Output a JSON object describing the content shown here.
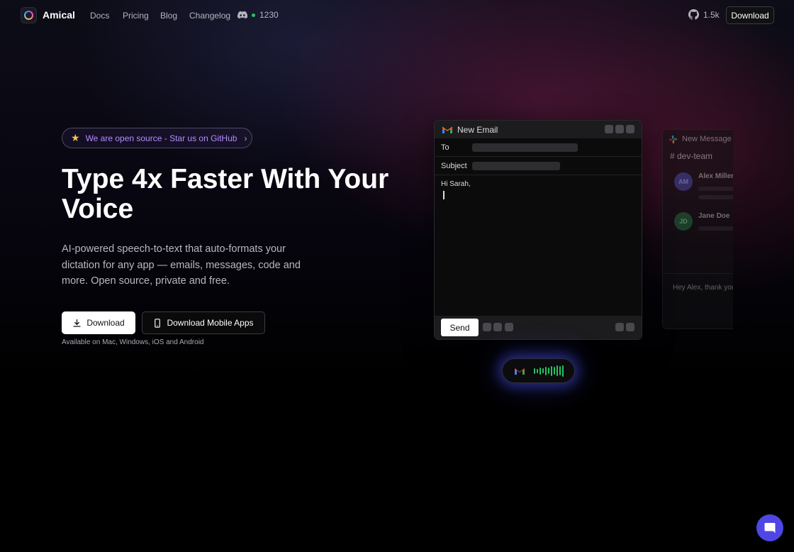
{
  "nav": {
    "brand": "Amical",
    "links": [
      "Docs",
      "Pricing",
      "Blog",
      "Changelog"
    ],
    "discord_count": "1230",
    "github_stars": "1.5k",
    "download_label": "Download"
  },
  "hero": {
    "badge_text": "We are open source - Star us on GitHub",
    "title": "Type 4x Faster With Your Voice",
    "subtitle": "AI-powered speech-to-text that auto-formats your dictation for any app — emails, messages, code and more. Open source, private and free.",
    "download_label": "Download",
    "mobile_label": "Download Mobile Apps",
    "availability": "Available on Mac, Windows, iOS and Android"
  },
  "email_window": {
    "title": "New Email",
    "to_label": "To",
    "subject_label": "Subject",
    "body_text": "Hi Sarah,",
    "send_label": "Send"
  },
  "slack_window": {
    "title": "New Message",
    "channel": "# dev-team",
    "users": [
      {
        "initials": "AM",
        "name": "Alex Miller",
        "color": "#3b4a9e"
      },
      {
        "initials": "JD",
        "name": "Jane Doe",
        "color": "#1f6b3a"
      }
    ],
    "draft": "Hey Alex, thank you for the OKRs, you are a star"
  },
  "colors": {
    "accent_purple": "#b58cff",
    "star": "#f5c542",
    "voice_green": "#22c55e",
    "fab_blue": "#4f46e5"
  },
  "icons": {
    "logo": "amical-logo",
    "discord": "discord-icon",
    "github": "github-icon",
    "download": "download-icon",
    "phone": "phone-icon",
    "gmail": "gmail-icon",
    "slack": "slack-icon",
    "chat": "chat-icon"
  }
}
